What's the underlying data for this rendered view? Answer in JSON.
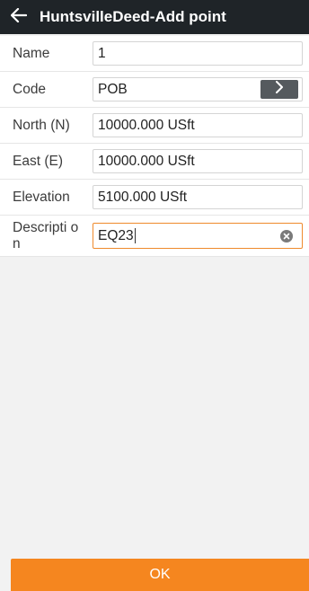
{
  "titlebar": {
    "title": "HuntsvilleDeed-Add point",
    "back_icon": "arrow-left-icon"
  },
  "form": {
    "name": {
      "label": "Name",
      "value": "1"
    },
    "code": {
      "label": "Code",
      "value": "POB",
      "button_icon": "chevron-right-icon"
    },
    "north": {
      "label": "North (N)",
      "value": "10000.000 USft"
    },
    "east": {
      "label": "East (E)",
      "value": "10000.000 USft"
    },
    "elevation": {
      "label": "Elevation",
      "value": "5100.000 USft"
    },
    "description": {
      "label": "Descripti on",
      "value": "EQ23",
      "clear_icon": "clear-icon"
    }
  },
  "footer": {
    "ok_label": "OK"
  },
  "colors": {
    "titlebar_bg": "#1f2428",
    "accent": "#f5861f",
    "focus_border": "#ef8a2c",
    "background": "#f2f2f2"
  }
}
